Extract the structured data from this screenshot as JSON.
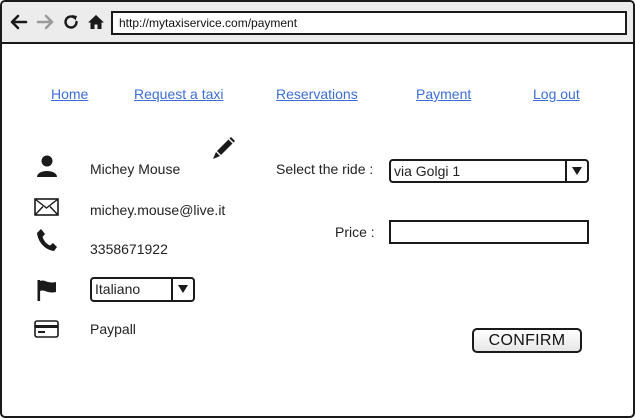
{
  "browser": {
    "back_icon": "arrow-left-icon",
    "forward_icon": "arrow-right-icon",
    "reload_icon": "reload-icon",
    "home_icon": "home-icon",
    "url": "http://mytaxiservice.com/payment"
  },
  "menu": {
    "items": [
      {
        "label": "Home"
      },
      {
        "label": "Request a taxi"
      },
      {
        "label": "Reservations"
      },
      {
        "label": "Payment"
      },
      {
        "label": "Log out"
      }
    ]
  },
  "profile": {
    "edit_icon": "pencil-icon",
    "name": "Michey Mouse",
    "email": "michey.mouse@live.it",
    "phone": "3358671922",
    "language": "Italiano",
    "payment_method": "Paypall"
  },
  "payment": {
    "ride_label": "Select the ride :",
    "ride_selected": "via Golgi 1",
    "price_label": "Price :",
    "price_value": "",
    "confirm_label": "CONFIRM"
  },
  "colors": {
    "link": "#3b6fd6",
    "border": "#1a1a1a",
    "browser_bar": "#ececec"
  }
}
